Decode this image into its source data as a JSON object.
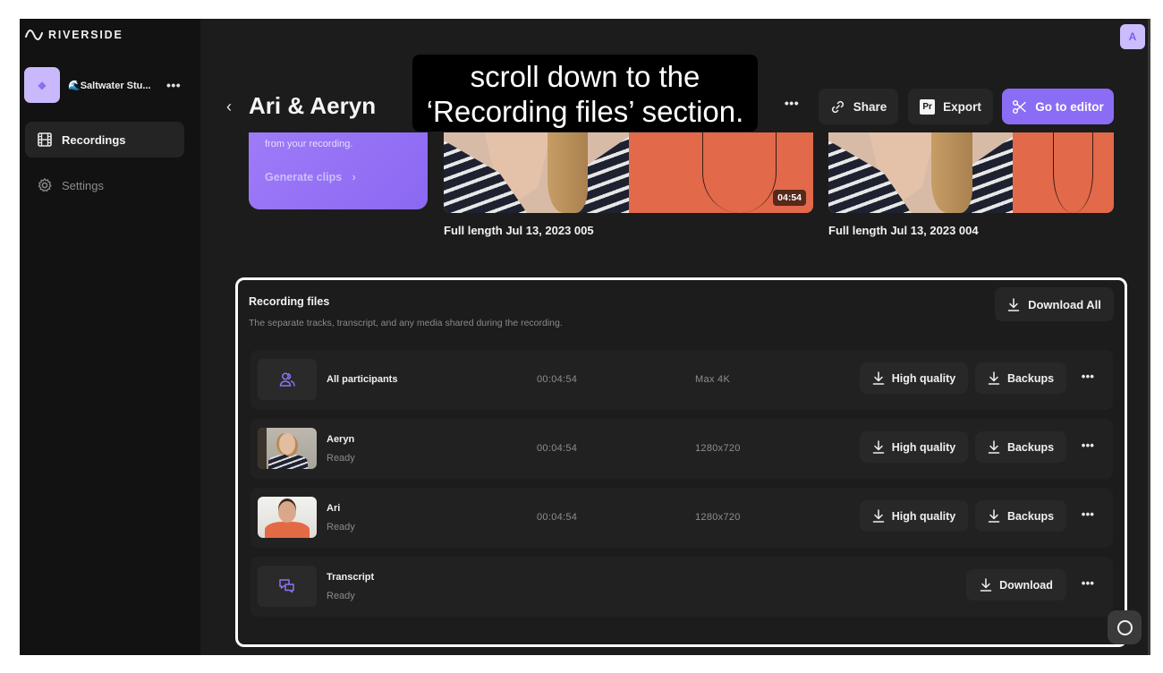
{
  "brand": {
    "name": "RIVERSIDE"
  },
  "sidebar": {
    "workspace": {
      "name": "🌊Saltwater Stu...",
      "more": "•••"
    },
    "items": [
      {
        "label": "Recordings",
        "icon": "film-icon",
        "active": true
      },
      {
        "label": "Settings",
        "icon": "gear-icon",
        "active": false
      }
    ]
  },
  "header": {
    "user_initial": "A",
    "back": "‹",
    "title": "Ari & Aeryn",
    "more": "•••",
    "share_label": "Share",
    "export_label": "Export",
    "export_icon_text": "Pr",
    "editor_label": "Go to editor"
  },
  "caption": {
    "line1": "scroll down to the",
    "line2": "‘Recording files’ section."
  },
  "clips_card": {
    "description": "from your recording.",
    "link_label": "Generate clips",
    "link_chevron": "›"
  },
  "videos": [
    {
      "title": "Full length Jul 13, 2023 005",
      "duration": "04:54"
    },
    {
      "title": "Full length Jul 13, 2023 004"
    }
  ],
  "recording_files": {
    "title": "Recording files",
    "subtitle": "The separate tracks, transcript, and any media shared during the recording.",
    "download_all_label": "Download All",
    "rows": [
      {
        "name": "All participants",
        "status": "",
        "duration": "00:04:54",
        "resolution": "Max 4K",
        "hq_label": "High quality",
        "backups_label": "Backups",
        "more": "•••"
      },
      {
        "name": "Aeryn",
        "status": "Ready",
        "duration": "00:04:54",
        "resolution": "1280x720",
        "hq_label": "High quality",
        "backups_label": "Backups",
        "more": "•••"
      },
      {
        "name": "Ari",
        "status": "Ready",
        "duration": "00:04:54",
        "resolution": "1280x720",
        "hq_label": "High quality",
        "backups_label": "Backups",
        "more": "•••"
      },
      {
        "name": "Transcript",
        "status": "Ready",
        "download_label": "Download",
        "more": "•••"
      }
    ]
  },
  "colors": {
    "accent": "#8b6cf4",
    "background": "#1c1c1c",
    "sidebar": "#121212",
    "highlight": "#ffffff"
  }
}
